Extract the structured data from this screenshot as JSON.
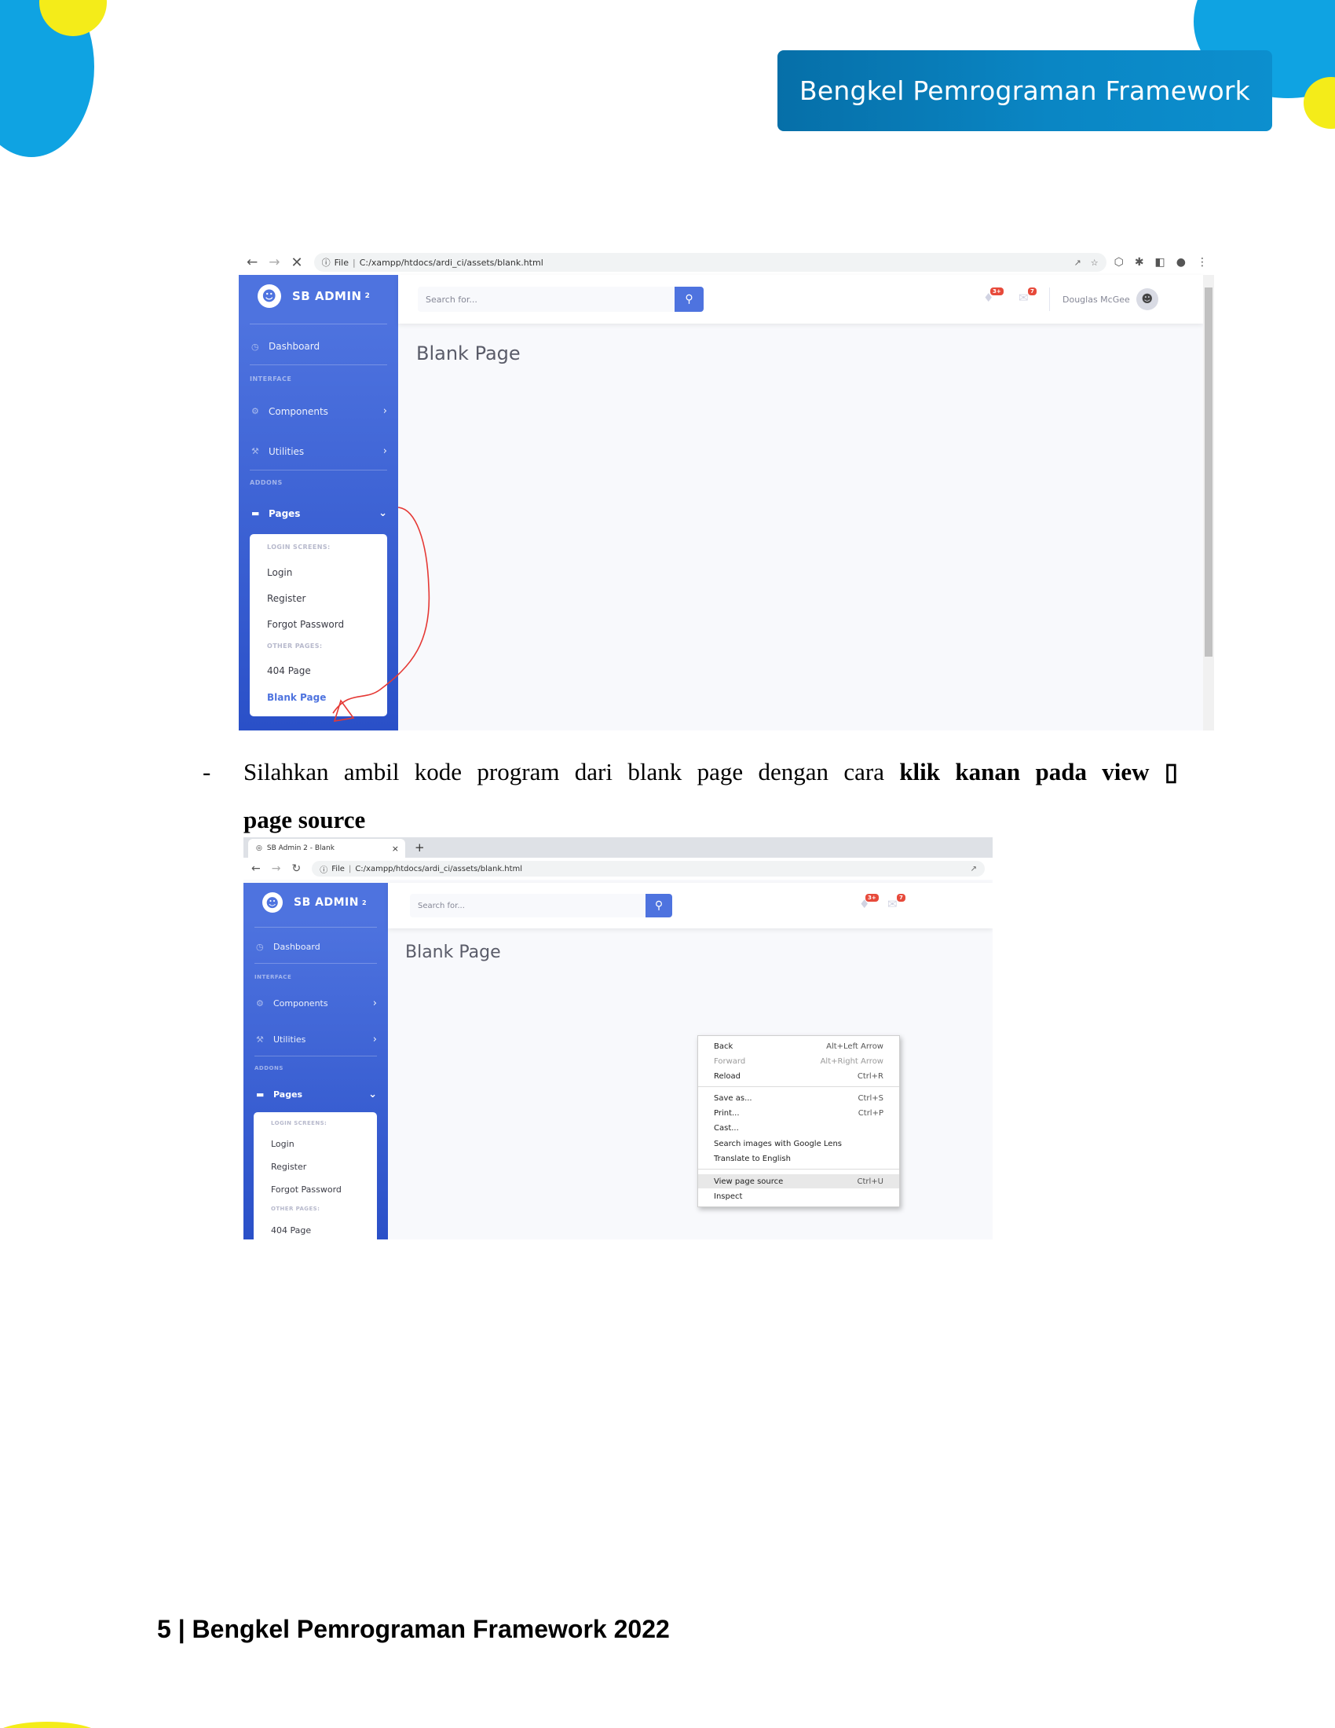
{
  "header": {
    "title": "Bengkel Pemrograman Framework"
  },
  "shot1": {
    "url_file": "File",
    "url_path": "C:/xampp/htdocs/ardi_ci/assets/blank.html",
    "brand": "SB ADMIN",
    "brand_sup": "2",
    "sidebar": {
      "dashboard": "Dashboard",
      "heading_interface": "INTERFACE",
      "components": "Components",
      "utilities": "Utilities",
      "heading_addons": "ADDONS",
      "pages": "Pages",
      "login_screens": "LOGIN SCREENS:",
      "login": "Login",
      "register": "Register",
      "forgot_password": "Forgot Password",
      "other_pages": "OTHER PAGES:",
      "page_404": "404 Page",
      "blank_page": "Blank Page"
    },
    "search_placeholder": "Search for...",
    "alerts_badge": "3+",
    "messages_badge": "7",
    "user_name": "Douglas McGee",
    "page_title": "Blank Page"
  },
  "instruction": {
    "dash": "-",
    "text_plain": "Silahkan ambil kode program dari blank page dengan cara ",
    "text_bold": "klik kanan pada view ▯",
    "text_line2": "page source"
  },
  "shot2": {
    "tab_title": "SB Admin 2 - Blank",
    "tab_close": "×",
    "new_tab": "+",
    "url_file": "File",
    "url_path": "C:/xampp/htdocs/ardi_ci/assets/blank.html",
    "brand": "SB ADMIN",
    "brand_sup": "2",
    "sidebar": {
      "dashboard": "Dashboard",
      "heading_interface": "INTERFACE",
      "components": "Components",
      "utilities": "Utilities",
      "heading_addons": "ADDONS",
      "pages": "Pages",
      "login_screens": "LOGIN SCREENS:",
      "login": "Login",
      "register": "Register",
      "forgot_password": "Forgot Password",
      "other_pages": "OTHER PAGES:",
      "page_404": "404 Page"
    },
    "search_placeholder": "Search for...",
    "alerts_badge": "3+",
    "messages_badge": "7",
    "page_title": "Blank Page",
    "context_menu": {
      "back": "Back",
      "back_sc": "Alt+Left Arrow",
      "forward": "Forward",
      "forward_sc": "Alt+Right Arrow",
      "reload": "Reload",
      "reload_sc": "Ctrl+R",
      "save_as": "Save as...",
      "save_as_sc": "Ctrl+S",
      "print": "Print...",
      "print_sc": "Ctrl+P",
      "cast": "Cast...",
      "search_lens": "Search images with Google Lens",
      "translate": "Translate to English",
      "view_source": "View page source",
      "view_source_sc": "Ctrl+U",
      "inspect": "Inspect"
    }
  },
  "footer": {
    "text": "5 | Bengkel Pemrograman Framework 2022"
  },
  "colors": {
    "accent": "#0fa3e2",
    "yellow": "#f4ec19",
    "sb_primary": "#4e73df",
    "annotation": "#e53935"
  }
}
